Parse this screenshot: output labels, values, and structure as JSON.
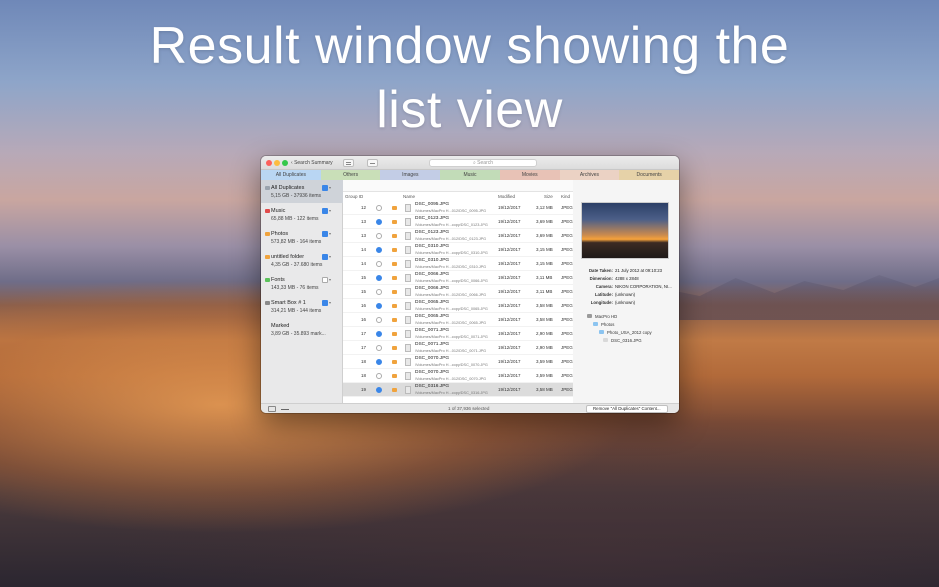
{
  "headline": {
    "line1": "Result window showing the",
    "line2": "list view"
  },
  "window": {
    "back_label": "Search Summary",
    "search_placeholder": "Search",
    "tabs": [
      {
        "label": "All Duplicates",
        "color": "#b9d6f3"
      },
      {
        "label": "Others",
        "color": "#c9dfb8"
      },
      {
        "label": "Images",
        "color": "#c3cde6"
      },
      {
        "label": "Music",
        "color": "#c2dcb8"
      },
      {
        "label": "Movies",
        "color": "#e8c2b6"
      },
      {
        "label": "Archives",
        "color": "#ebd2c4"
      },
      {
        "label": "Documents",
        "color": "#e6d2a8"
      }
    ],
    "sidebar": [
      {
        "name": "All Duplicates",
        "sub": "5,15 GB - 37936 items",
        "color": "#9aa3ad",
        "checked": true
      },
      {
        "name": "Music",
        "sub": "65,88 MB - 122 items",
        "color": "#e14b4b",
        "checked": true
      },
      {
        "name": "Photos",
        "sub": "573,82 MB - 164 items",
        "color": "#f0a33d",
        "checked": true
      },
      {
        "name": "untitled folder",
        "sub": "4,35 GB - 37.680 items",
        "color": "#f0a33d",
        "checked": true
      },
      {
        "name": "Fonts",
        "sub": "143,33 MB - 76 items",
        "color": "#5bc25b",
        "checked": false
      },
      {
        "name": "Smart Box # 1",
        "sub": "314,21 MB - 144 items",
        "color": "#8a8a8a",
        "checked": true
      },
      {
        "name": "Marked",
        "sub": "3,89 GB - 35.893 mark...",
        "color": "",
        "checked": false
      }
    ],
    "columns": {
      "group_id": "Group ID",
      "name": "Name",
      "modified": "Modified",
      "size": "Size",
      "kind": "Kind"
    },
    "rows": [
      {
        "group": "12",
        "checked": false,
        "name": "DSC_0095.JPG",
        "path": "/Volumes/MacPro H...012/DSC_0095.JPG",
        "modified": "19/12/2017",
        "size": "3,12 MB",
        "kind": "JPEG"
      },
      {
        "group": "13",
        "checked": true,
        "name": "DSC_0123.JPG",
        "path": "/Volumes/MacPro H...copy/DSC_0123.JPG",
        "modified": "19/12/2017",
        "size": "3,69 MB",
        "kind": "JPEG"
      },
      {
        "group": "13",
        "checked": false,
        "name": "DSC_0123.JPG",
        "path": "/Volumes/MacPro H...012/DSC_0123.JPG",
        "modified": "19/12/2017",
        "size": "3,69 MB",
        "kind": "JPEG"
      },
      {
        "group": "14",
        "checked": true,
        "name": "DSC_0310.JPG",
        "path": "/Volumes/MacPro H...copy/DSC_0310.JPG",
        "modified": "19/12/2017",
        "size": "3,15 MB",
        "kind": "JPEG"
      },
      {
        "group": "14",
        "checked": false,
        "name": "DSC_0310.JPG",
        "path": "/Volumes/MacPro H...012/DSC_0310.JPG",
        "modified": "19/12/2017",
        "size": "3,15 MB",
        "kind": "JPEG"
      },
      {
        "group": "15",
        "checked": true,
        "name": "DSC_0066.JPG",
        "path": "/Volumes/MacPro H...copy/DSC_0066.JPG",
        "modified": "19/12/2017",
        "size": "3,11 MB",
        "kind": "JPEG"
      },
      {
        "group": "15",
        "checked": false,
        "name": "DSC_0066.JPG",
        "path": "/Volumes/MacPro H...012/DSC_0066.JPG",
        "modified": "19/12/2017",
        "size": "3,11 MB",
        "kind": "JPEG"
      },
      {
        "group": "16",
        "checked": true,
        "name": "DSC_0065.JPG",
        "path": "/Volumes/MacPro H...copy/DSC_0065.JPG",
        "modified": "19/12/2017",
        "size": "3,58 MB",
        "kind": "JPEG"
      },
      {
        "group": "16",
        "checked": false,
        "name": "DSC_0065.JPG",
        "path": "/Volumes/MacPro H...012/DSC_0065.JPG",
        "modified": "19/12/2017",
        "size": "3,58 MB",
        "kind": "JPEG"
      },
      {
        "group": "17",
        "checked": true,
        "name": "DSC_0071.JPG",
        "path": "/Volumes/MacPro H...copy/DSC_0071.JPG",
        "modified": "19/12/2017",
        "size": "2,90 MB",
        "kind": "JPEG"
      },
      {
        "group": "17",
        "checked": false,
        "name": "DSC_0071.JPG",
        "path": "/Volumes/MacPro H...012/DSC_0071.JPG",
        "modified": "19/12/2017",
        "size": "2,90 MB",
        "kind": "JPEG"
      },
      {
        "group": "18",
        "checked": true,
        "name": "DSC_0070.JPG",
        "path": "/Volumes/MacPro H...copy/DSC_0070.JPG",
        "modified": "19/12/2017",
        "size": "3,59 MB",
        "kind": "JPEG"
      },
      {
        "group": "18",
        "checked": false,
        "name": "DSC_0070.JPG",
        "path": "/Volumes/MacPro H...012/DSC_0070.JPG",
        "modified": "19/12/2017",
        "size": "3,59 MB",
        "kind": "JPEG"
      },
      {
        "group": "19",
        "checked": true,
        "name": "DSC_0316.JPG",
        "path": "/Volumes/MacPro H...copy/DSC_0316.JPG",
        "modified": "19/12/2017",
        "size": "3,58 MB",
        "kind": "JPEG",
        "selected": true
      }
    ],
    "preview": {
      "meta": [
        {
          "label": "Date Taken:",
          "value": "21 July 2012 at 09:10:23"
        },
        {
          "label": "Dimension:",
          "value": "4288 x 2848"
        },
        {
          "label": "Camera:",
          "value": "NIKON CORPORATION, NI..."
        },
        {
          "label": "Latitude:",
          "value": "(unknown)"
        },
        {
          "label": "Longitude:",
          "value": "(unknown)"
        }
      ],
      "tree": [
        "MacPro HD",
        "Photos",
        "Photo_USA_2012 copy",
        "DSC_0316.JPG"
      ]
    },
    "status": "1 of 37,936 selected",
    "remove_label": "Remove \"All Duplicates\" Content..."
  }
}
